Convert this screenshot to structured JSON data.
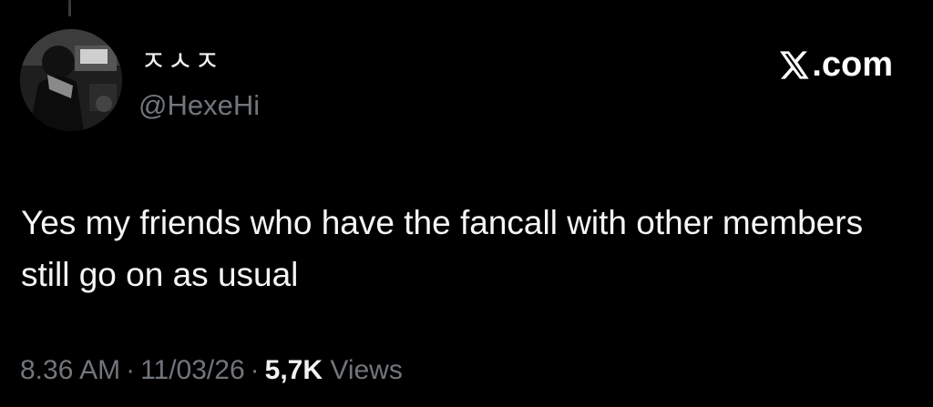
{
  "author": {
    "display_name": "ㅈㅅㅈ",
    "handle": "@HexeHi"
  },
  "brand": {
    "icon": "x-logo-icon",
    "label": ".com"
  },
  "tweet": {
    "text": "Yes my friends who have the fancall with other members still go on as usual"
  },
  "meta": {
    "time": "8.36 AM",
    "separator": "·",
    "date": "11/03/26",
    "views_count": "5,7K",
    "views_label": "Views"
  },
  "colors": {
    "background": "#000000",
    "text": "#e7e9ea",
    "secondary": "#71767b"
  }
}
